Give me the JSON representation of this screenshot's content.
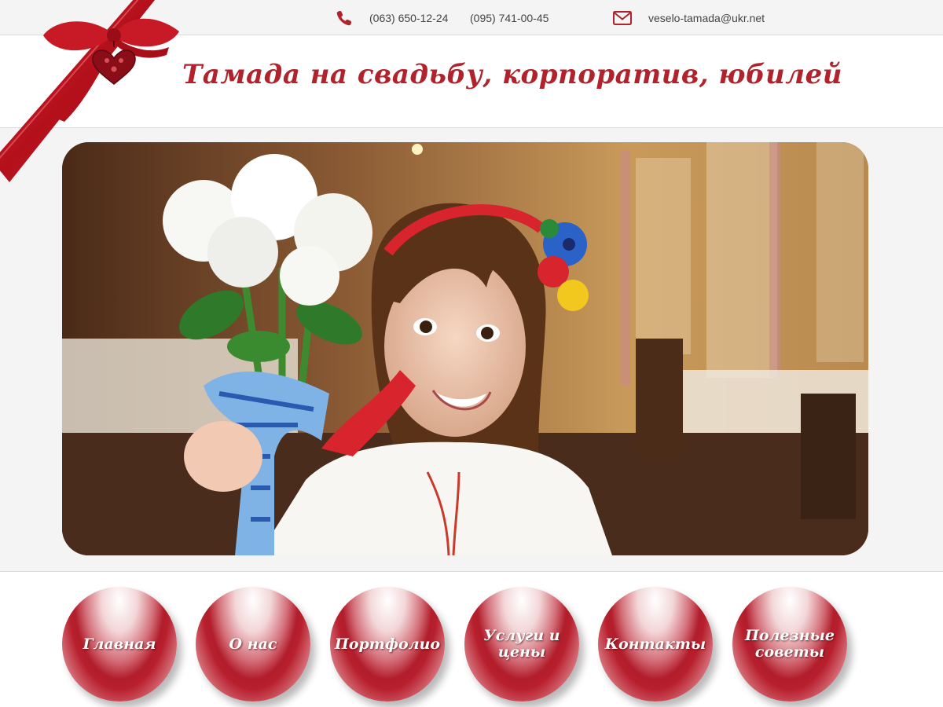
{
  "header": {
    "phone_1": "(063) 650-12-24",
    "phone_2": "(095) 741-00-45",
    "email": "veselo-tamada@ukr.net",
    "icons": [
      "phone-icon",
      "mail-icon"
    ]
  },
  "site": {
    "title": "Тамада на свадьбу, корпоратив, юбилей"
  },
  "nav": {
    "items": [
      {
        "label": "Главная"
      },
      {
        "label": "О нас"
      },
      {
        "label": "Портфолио"
      },
      {
        "label": "Услуги и цены"
      },
      {
        "label": "Контакты"
      },
      {
        "label": "Полезные советы"
      }
    ]
  },
  "colors": {
    "accent": "#b0232c",
    "background": "#f4f4f4",
    "nav_button": "#b81f2d"
  }
}
